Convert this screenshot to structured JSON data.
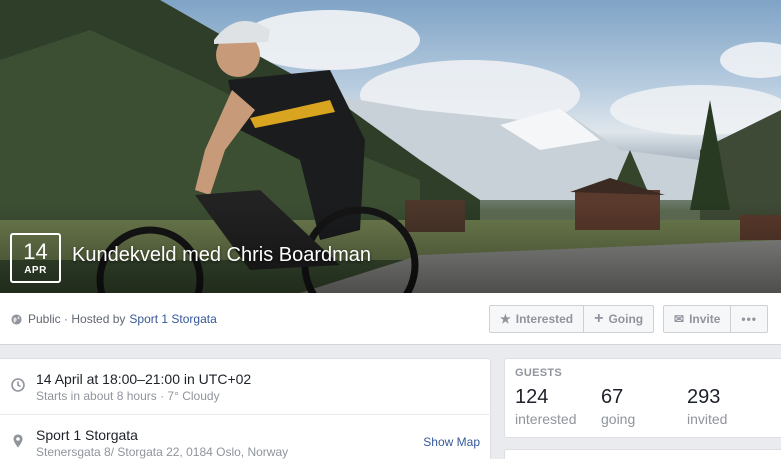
{
  "event": {
    "date_day": "14",
    "date_month": "APR",
    "title": "Kundekveld med Chris Boardman"
  },
  "info_bar": {
    "privacy": "Public · Hosted by",
    "host": "Sport 1 Storgata",
    "buttons": {
      "interested": "Interested",
      "going": "Going",
      "invite": "Invite",
      "more": "•••"
    }
  },
  "details": {
    "time_main": "14 April at 18:00–21:00 in UTC+02",
    "time_sub": "Starts in about 8 hours · 7° Cloudy",
    "place_main": "Sport 1 Storgata",
    "place_sub": "Stenersgata 8/ Storgata 22, 0184 Oslo, Norway",
    "show_map": "Show Map"
  },
  "guests": {
    "title": "GUESTS",
    "stats": [
      {
        "count": "124",
        "label": "interested"
      },
      {
        "count": "67",
        "label": "going"
      },
      {
        "count": "293",
        "label": "invited"
      }
    ]
  },
  "icons": [
    "globe-icon",
    "star-icon",
    "plus-icon",
    "envelope-icon",
    "clock-icon",
    "location-pin-icon"
  ],
  "colors": {
    "link": "#365899",
    "muted": "#90949c",
    "background": "#e9ebee"
  }
}
